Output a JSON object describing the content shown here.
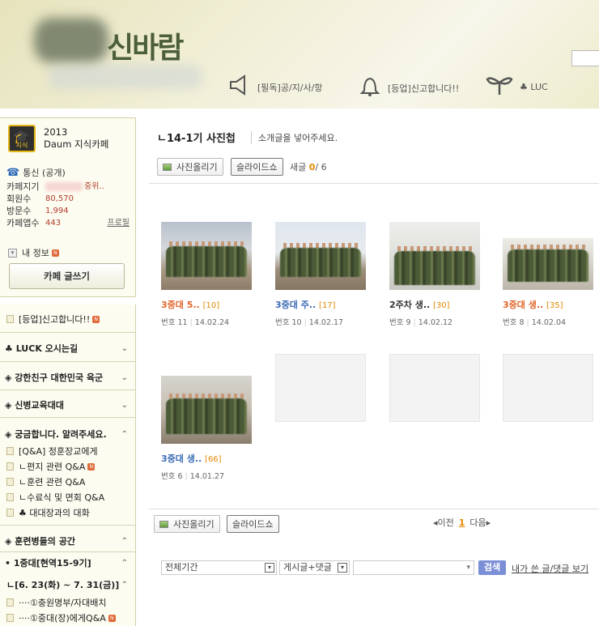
{
  "header": {
    "logo_text": "신바람",
    "nav": [
      {
        "icon": "megaphone-icon",
        "label": "[필독]공/지/사/항"
      },
      {
        "icon": "bell-icon",
        "label": "[등업]신고합니다!!"
      },
      {
        "icon": "sprout-icon",
        "label": "♣ LUC"
      }
    ]
  },
  "sidebar": {
    "badge_label": "지식",
    "cafe_year": "2013",
    "cafe_award": "Daum 지식카페",
    "rank_label": "통신 (공개)",
    "stats": [
      {
        "key": "카페지기",
        "value": "중위.."
      },
      {
        "key": "회원수",
        "value": "80,570"
      },
      {
        "key": "방문수",
        "value": "1,994"
      },
      {
        "key": "카페앱수",
        "value": "443"
      }
    ],
    "profile_link": "프로필",
    "my_info": "내 정보",
    "write_button": "카페 글쓰기",
    "menu": [
      {
        "label": "[등업]신고합니다!!"
      },
      {
        "label": "♣ LUCK 오시는길"
      },
      {
        "label": "◈ 강한친구 대한민국 육군"
      },
      {
        "label": "◈ 신병교육대대"
      },
      {
        "label": "◈ 궁금합니다. 알려주세요."
      },
      {
        "label": "[Q&A] 정훈장교에게"
      },
      {
        "label": "ㄴ편지 관련 Q&A"
      },
      {
        "label": "ㄴ훈련 관련 Q&A"
      },
      {
        "label": "ㄴ수료식 및 면회 Q&A"
      },
      {
        "label": "♣ 대대장과의 대화"
      },
      {
        "label": "◈ 훈련병들의 공간"
      },
      {
        "label": "• 1중대[현역15-9기]"
      },
      {
        "label": "ㄴ[6. 23(화) ~ 7. 31(금)]"
      },
      {
        "label": "····①충원명부/자대배치"
      },
      {
        "label": "····①중대(장)에게Q&A"
      }
    ]
  },
  "main": {
    "title": "ㄴ14-1기 사진첩",
    "description": "소개글을 넣어주세요.",
    "upload_button": "사진올리기",
    "slideshow_button": "슬라이드쇼",
    "new_label": "새글",
    "new_count": "0",
    "new_total": "/ 6",
    "photos": [
      {
        "title": "3중대 5..",
        "count": "[10]",
        "number": "번호 11",
        "date": "14.02.24",
        "title_color": "#e0662a"
      },
      {
        "title": "3중대 주..",
        "count": "[17]",
        "number": "번호 10",
        "date": "14.02.17",
        "title_color": "#3b6bb5"
      },
      {
        "title": "2주차 생..",
        "count": "[30]",
        "number": "번호 9",
        "date": "14.02.12",
        "title_color": "#333333"
      },
      {
        "title": "3중대 생..",
        "count": "[35]",
        "number": "번호 8",
        "date": "14.02.04",
        "title_color": "#e0662a"
      },
      {
        "title": "3중대 생..",
        "count": "[66]",
        "number": "번호 6",
        "date": "14.01.27",
        "title_color": "#3b6bb5"
      }
    ],
    "paging": {
      "prev": "◂이전",
      "current": "1",
      "next": "다음▸"
    },
    "search": {
      "period": "전체기간",
      "target": "게시글+댓글",
      "query": "",
      "button": "검색",
      "my_posts": "내가 쓴 글/댓글 보기"
    }
  }
}
